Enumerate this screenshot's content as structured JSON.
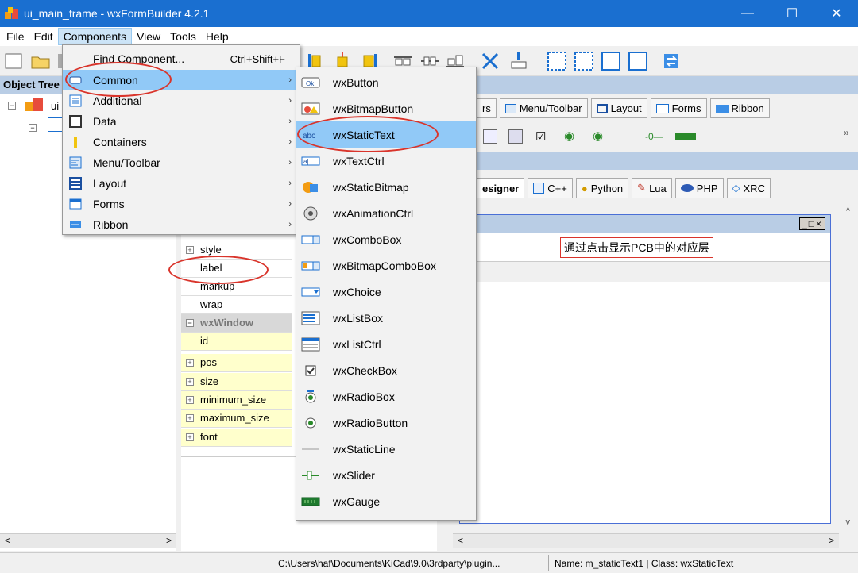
{
  "window": {
    "title": "ui_main_frame - wxFormBuilder 4.2.1",
    "minimize": "—",
    "maximize": "☐",
    "close": "✕"
  },
  "menubar": [
    "File",
    "Edit",
    "Components",
    "View",
    "Tools",
    "Help"
  ],
  "left_panel": {
    "header": "Object Tree",
    "root_label": "ui"
  },
  "components_menu": {
    "find": {
      "label": "Find Component...",
      "shortcut": "Ctrl+Shift+F"
    },
    "items": [
      "Common",
      "Additional",
      "Data",
      "Containers",
      "Menu/Toolbar",
      "Layout",
      "Forms",
      "Ribbon"
    ],
    "arrow": "›"
  },
  "common_submenu": [
    "wxButton",
    "wxBitmapButton",
    "wxStaticText",
    "wxTextCtrl",
    "wxStaticBitmap",
    "wxAnimationCtrl",
    "wxComboBox",
    "wxBitmapComboBox",
    "wxChoice",
    "wxListBox",
    "wxListCtrl",
    "wxCheckBox",
    "wxRadioBox",
    "wxRadioButton",
    "wxStaticLine",
    "wxSlider",
    "wxGauge"
  ],
  "palette_tabs": [
    "rs",
    "Menu/Toolbar",
    "Layout",
    "Forms",
    "Ribbon"
  ],
  "editor_tabs": [
    "esigner",
    "C++",
    "Python",
    "Lua",
    "PHP",
    "XRC"
  ],
  "properties": {
    "rows": [
      "style",
      "label",
      "markup",
      "wrap"
    ],
    "group": "wxWindow",
    "window_rows": [
      "id",
      "pos",
      "size",
      "minimum_size",
      "maximum_size",
      "font"
    ]
  },
  "designer": {
    "static_text": "通过点击显示PCB中的对应层",
    "frame_buttons": "_□×"
  },
  "statusbar": {
    "path": "C:\\Users\\haf\\Documents\\KiCad\\9.0\\3rdparty\\plugin...",
    "info": "Name: m_staticText1 | Class: wxStaticText"
  },
  "colors": {
    "titlebar": "#1a6fd0",
    "highlight": "#91c9f7",
    "annotation": "#d9342b",
    "panel_header": "#b9cde5",
    "property_yellow": "#ffffcc"
  },
  "annotations": [
    "Common",
    "wxStaticText",
    "label"
  ]
}
